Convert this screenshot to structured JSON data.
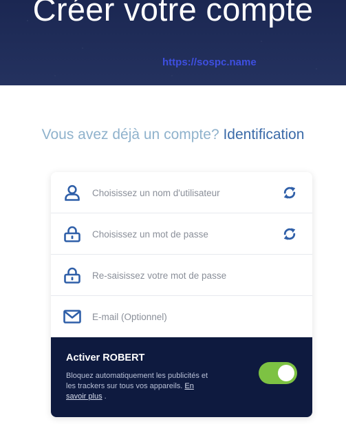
{
  "header": {
    "title": "Créer votre compte",
    "watermark": "https://sospc.name"
  },
  "login_prompt": {
    "question": "Vous avez déjà un compte?",
    "link": "Identification"
  },
  "form": {
    "username_placeholder": "Choisissez un nom d'utilisateur",
    "password_placeholder": "Choisissez un mot de passe",
    "password_confirm_placeholder": "Re-saisissez votre mot de passe",
    "email_placeholder": "E-mail (Optionnel)"
  },
  "robert": {
    "title": "Activer ROBERT",
    "description": "Bloquez automatiquement les publicités et les trackers sur tous vos appareils.",
    "learn_more": "En savoir plus",
    "after_link": ".",
    "enabled": true
  },
  "colors": {
    "header_bg": "#1b2752",
    "accent_blue": "#2f5fa8",
    "panel_bg": "#0e1a3f",
    "toggle_on": "#7dc243"
  },
  "icons": [
    "user-icon",
    "lock-icon",
    "refresh-icon",
    "mail-icon"
  ]
}
